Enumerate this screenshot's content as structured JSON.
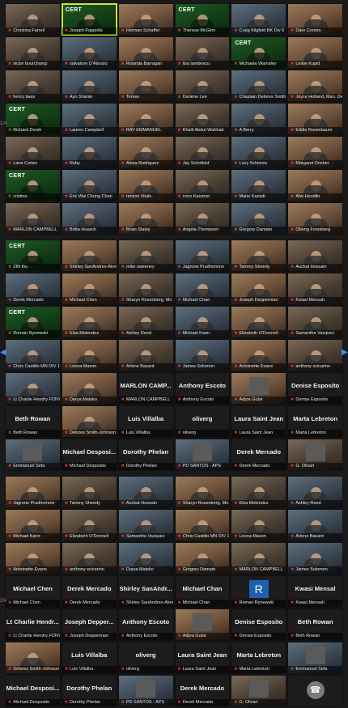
{
  "meeting": {
    "app": "Zoom",
    "accent": "#c8e33a",
    "mic_muted_color": "#e53935"
  },
  "gallery_pages": [
    {
      "pager": "1/4",
      "tiles": [
        {
          "name": "Christina Farrell",
          "kind": "video"
        },
        {
          "name": "Joseph Pappolla",
          "kind": "green",
          "active": true
        },
        {
          "name": "Herman Schaffer",
          "kind": "video"
        },
        {
          "name": "Therese McGinn",
          "kind": "green"
        },
        {
          "name": "Craig Kilgfeld BK Div 5",
          "kind": "video"
        },
        {
          "name": "Dare Cremin",
          "kind": "video"
        },
        {
          "name": "victor bourchamp",
          "kind": "video"
        },
        {
          "name": "salvatore D'Alessio",
          "kind": "video"
        },
        {
          "name": "Rosinda Barragan",
          "kind": "video"
        },
        {
          "name": "lisa lambesco",
          "kind": "video"
        },
        {
          "name": "Michaela Wamsley",
          "kind": "green"
        },
        {
          "name": "Leslie Kupid",
          "kind": "video"
        },
        {
          "name": "henry bass",
          "kind": "video"
        },
        {
          "name": "Ayo Shante",
          "kind": "video"
        },
        {
          "name": "Terese",
          "kind": "video"
        },
        {
          "name": "Darlene Lee",
          "kind": "video"
        },
        {
          "name": "Chaplain Delores Smith...",
          "kind": "video"
        },
        {
          "name": "Joyce Holland, Man. De...",
          "kind": "video"
        },
        {
          "name": "Richard Dorsh",
          "kind": "green"
        },
        {
          "name": "Lauren Campbell",
          "kind": "video"
        },
        {
          "name": "RAY EMMANUEL",
          "kind": "video"
        },
        {
          "name": "Khalil Abdul-Wahhab",
          "kind": "video"
        },
        {
          "name": "A Berry",
          "kind": "video"
        },
        {
          "name": "Eddie Rosenbaum",
          "kind": "video"
        },
        {
          "name": "Lana Cortes",
          "kind": "video"
        },
        {
          "name": "Ruby",
          "kind": "video"
        },
        {
          "name": "Alexa Rodriguez",
          "kind": "video"
        },
        {
          "name": "Jay Schofield",
          "kind": "video"
        },
        {
          "name": "Lucy Schieres",
          "kind": "video"
        },
        {
          "name": "Margaret Dosher",
          "kind": "video"
        },
        {
          "name": "cristine",
          "kind": "green"
        },
        {
          "name": "Eric Wai Chung Chan",
          "kind": "video"
        },
        {
          "name": "renzini Vitale",
          "kind": "video"
        },
        {
          "name": "coco Kaumon",
          "kind": "video"
        },
        {
          "name": "Marie Kazadi",
          "kind": "video"
        },
        {
          "name": "Abe Hendlin",
          "kind": "video"
        },
        {
          "name": "MARLON CAMPBELL",
          "kind": "video"
        },
        {
          "name": "Britta Husack",
          "kind": "video"
        },
        {
          "name": "Brian Staley",
          "kind": "video"
        },
        {
          "name": "Angela Thompson",
          "kind": "video"
        },
        {
          "name": "Gregory Damato",
          "kind": "video"
        },
        {
          "name": "Obeng Forssberg",
          "kind": "video"
        }
      ]
    },
    {
      "pager": "2/4",
      "tiles": [
        {
          "name": "ZIN thu",
          "kind": "green"
        },
        {
          "name": "Shirley SanAndres-Alon...",
          "kind": "video"
        },
        {
          "name": "mike sweeney",
          "kind": "video"
        },
        {
          "name": "Jagrone Prudhomme",
          "kind": "video"
        },
        {
          "name": "Tammy Sheedy",
          "kind": "video"
        },
        {
          "name": "Auckat Hossain",
          "kind": "video"
        },
        {
          "name": "Derek Mercado",
          "kind": "video"
        },
        {
          "name": "Michael Chen",
          "kind": "video"
        },
        {
          "name": "Sharyn Rosenberg, Mn...",
          "kind": "video"
        },
        {
          "name": "Michael Chan",
          "kind": "video"
        },
        {
          "name": "Joseph Depperman",
          "kind": "video"
        },
        {
          "name": "Kwasi Mensah",
          "kind": "video"
        },
        {
          "name": "Roman Rynewski",
          "kind": "green"
        },
        {
          "name": "Elsa Melendez",
          "kind": "video"
        },
        {
          "name": "Ashley Reed",
          "kind": "video"
        },
        {
          "name": "Michael Kann",
          "kind": "video"
        },
        {
          "name": "Elizabeth O'Donnell",
          "kind": "video"
        },
        {
          "name": "Samantha Vazquez",
          "kind": "video"
        },
        {
          "name": "Chris Castillo MN DIV 1...",
          "kind": "video"
        },
        {
          "name": "Leona Mason",
          "kind": "video"
        },
        {
          "name": "Arlene Basant",
          "kind": "video"
        },
        {
          "name": "James Solomon",
          "kind": "video"
        },
        {
          "name": "Antoinette Evans",
          "kind": "video"
        },
        {
          "name": "anthony scicarino",
          "kind": "video"
        },
        {
          "name": "Lt Charlie Hendry FDNY",
          "kind": "video"
        },
        {
          "name": "Darya Matsko",
          "kind": "video"
        },
        {
          "name": "MARLON CAMPBELL",
          "kind": "text",
          "big": "MARLON CAMP..."
        },
        {
          "name": "Anthony Escoto",
          "kind": "text",
          "big": "Anthony Escoto"
        },
        {
          "name": "Adjoa Gube",
          "kind": "photo"
        },
        {
          "name": "Denise Esposito",
          "kind": "text",
          "big": "Denise Esposito"
        },
        {
          "name": "Beth Rowan",
          "kind": "text",
          "big": "Beth Rowan"
        },
        {
          "name": "Delores Smith-Johnson",
          "kind": "video"
        },
        {
          "name": "Luis Villalba",
          "kind": "text",
          "big": "Luis Villalba"
        },
        {
          "name": "oliverg",
          "kind": "text",
          "big": "oliverg"
        },
        {
          "name": "Laura Saint Jean",
          "kind": "text",
          "big": "Laura Saint Jean"
        },
        {
          "name": "Marta Lebreton",
          "kind": "text",
          "big": "Marta Lebreton"
        },
        {
          "name": "Emmanuel Sefa",
          "kind": "photo"
        },
        {
          "name": "Michael Desposito",
          "kind": "text",
          "big": "Michael Desposi..."
        },
        {
          "name": "Dorothy Phelan",
          "kind": "text",
          "big": "Dorothy Phelan"
        },
        {
          "name": "PD SANTOS - APS",
          "kind": "photo"
        },
        {
          "name": "Derek Mercado",
          "kind": "text",
          "big": "Derek Mercado"
        },
        {
          "name": "G. Olivari",
          "kind": "photo"
        }
      ]
    },
    {
      "pager": "2/4",
      "tiles": [
        {
          "name": "Jagrone Prudhomme",
          "kind": "video"
        },
        {
          "name": "Tammy Sheedy",
          "kind": "video"
        },
        {
          "name": "Auckat Hossain",
          "kind": "video"
        },
        {
          "name": "Sharyn Rosenberg, Mn...",
          "kind": "video"
        },
        {
          "name": "Elsa Melendez",
          "kind": "video"
        },
        {
          "name": "Ashley Reed",
          "kind": "video"
        },
        {
          "name": "Michael Kann",
          "kind": "video"
        },
        {
          "name": "Elizabeth O'Donnell",
          "kind": "video"
        },
        {
          "name": "Samantha Vazquez",
          "kind": "video"
        },
        {
          "name": "Chris Castillo MN DIV 1...",
          "kind": "video"
        },
        {
          "name": "Leona Mason",
          "kind": "video"
        },
        {
          "name": "Arlene Basant",
          "kind": "video"
        },
        {
          "name": "Antoinette Evans",
          "kind": "video"
        },
        {
          "name": "anthony scicarino",
          "kind": "video"
        },
        {
          "name": "Darya Matsko",
          "kind": "video"
        },
        {
          "name": "Gregory Damato",
          "kind": "video"
        },
        {
          "name": "MARLON CAMPBELL",
          "kind": "video"
        },
        {
          "name": "James Solomon",
          "kind": "video"
        },
        {
          "name": "Michael Chen",
          "kind": "text",
          "big": "Michael Chen"
        },
        {
          "name": "Derek Mercado",
          "kind": "text",
          "big": "Derek Mercado"
        },
        {
          "name": "Shirley SanAndres-Alon...",
          "kind": "text",
          "big": "Shirley SanAndr..."
        },
        {
          "name": "Michael Chan",
          "kind": "text",
          "big": "Michael Chan"
        },
        {
          "name": "Roman Rynewski",
          "kind": "letter",
          "letter": "R"
        },
        {
          "name": "Kwasi Mensah",
          "kind": "text",
          "big": "Kwasi Mensal"
        },
        {
          "name": "Lt Charlie Hendry FDNY",
          "kind": "text",
          "big": "Lt Charlie Hendr..."
        },
        {
          "name": "Joseph Depperman",
          "kind": "text",
          "big": "Joseph Depper..."
        },
        {
          "name": "Anthony Escoto",
          "kind": "text",
          "big": "Anthony Escoto"
        },
        {
          "name": "Adjoa Gube",
          "kind": "photo"
        },
        {
          "name": "Denise Esposito",
          "kind": "text",
          "big": "Denise Esposito"
        },
        {
          "name": "Beth Rowan",
          "kind": "text",
          "big": "Beth Rowan"
        },
        {
          "name": "Delores Smith-Johnson",
          "kind": "video"
        },
        {
          "name": "Luis Villalba",
          "kind": "text",
          "big": "Luis Villalba"
        },
        {
          "name": "oliverg",
          "kind": "text",
          "big": "oliverg"
        },
        {
          "name": "Laura Saint Jean",
          "kind": "text",
          "big": "Laura Saint Jean"
        },
        {
          "name": "Marta Lebreton",
          "kind": "text",
          "big": "Marta Lebreton"
        },
        {
          "name": "Emmanuel Sefa",
          "kind": "photo"
        },
        {
          "name": "Michael Desposito",
          "kind": "text",
          "big": "Michael Desposi..."
        },
        {
          "name": "Dorothy Phelan",
          "kind": "text",
          "big": "Dorothy Phelan"
        },
        {
          "name": "PD SANTOS - APS",
          "kind": "photo"
        },
        {
          "name": "Derek Mercado",
          "kind": "text",
          "big": "Derek Mercado"
        },
        {
          "name": "G. Olivari",
          "kind": "photo"
        },
        {
          "name": "",
          "kind": "phone"
        }
      ]
    }
  ],
  "cert_label": "CERT",
  "icons": {
    "mic_muted": "mic-off-icon",
    "next_page": "chevron-right-icon",
    "prev_page": "chevron-left-icon",
    "phone": "phone-icon"
  }
}
